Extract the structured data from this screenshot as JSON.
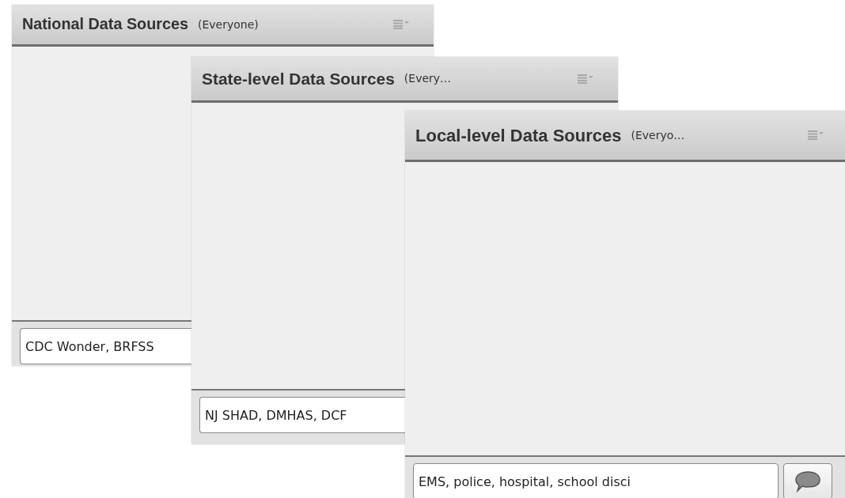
{
  "panels": [
    {
      "title": "National Data Sources",
      "audience": "(Everyone)",
      "input": "CDC Wonder, BRFSS"
    },
    {
      "title": "State-level Data Sources",
      "audience": "(Every…",
      "input": "NJ SHAD, DMHAS, DCF"
    },
    {
      "title": "Local-level Data Sources",
      "audience": "(Everyo…",
      "input": "EMS, police, hospital, school disci",
      "send_button": true
    }
  ]
}
